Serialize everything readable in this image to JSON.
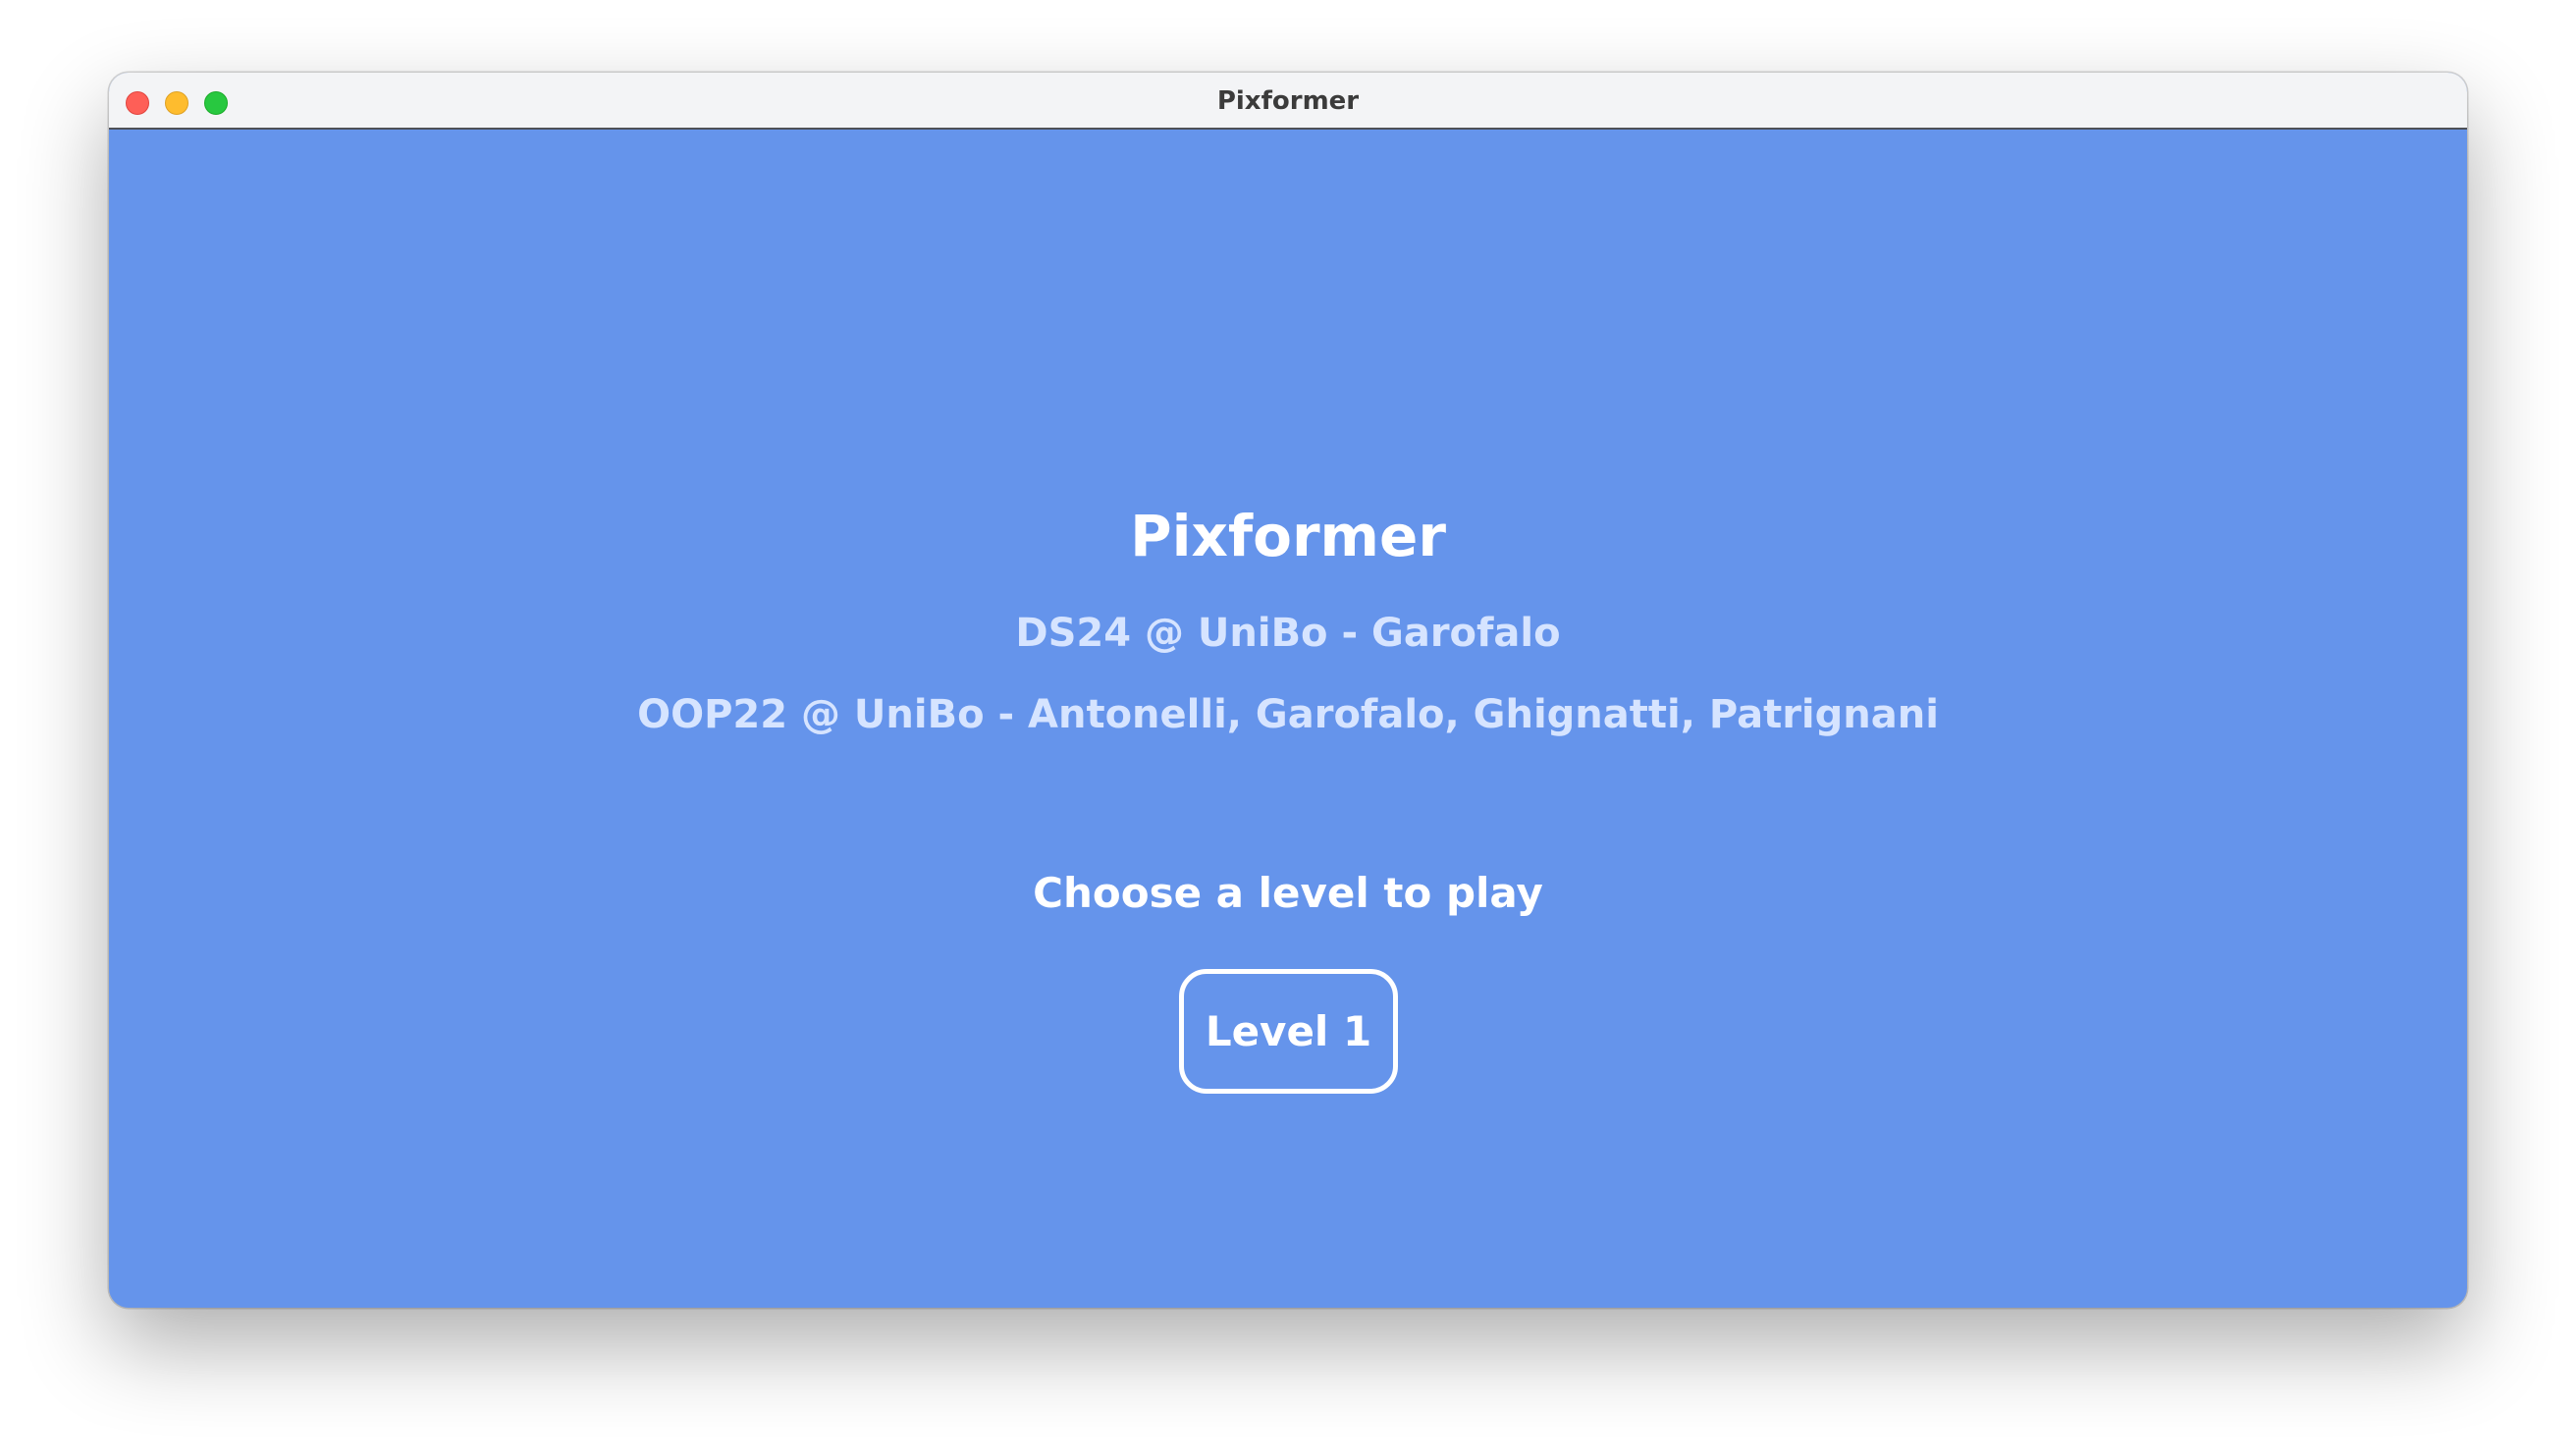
{
  "window": {
    "title": "Pixformer"
  },
  "colors": {
    "background": "#6594eb",
    "titlebar": "#f3f4f6",
    "title_text": "#ffffff",
    "credit_text": "#d6e4ff",
    "button_border": "#ffffff",
    "traffic_close": "#fe5f57",
    "traffic_minimize": "#febc2e",
    "traffic_zoom": "#28c840"
  },
  "menu": {
    "title": "Pixformer",
    "credits": [
      "DS24 @ UniBo - Garofalo",
      "OOP22 @ UniBo - Antonelli, Garofalo, Ghignatti, Patrignani"
    ],
    "prompt": "Choose a level to play",
    "levels": [
      {
        "label": "Level 1"
      }
    ]
  }
}
